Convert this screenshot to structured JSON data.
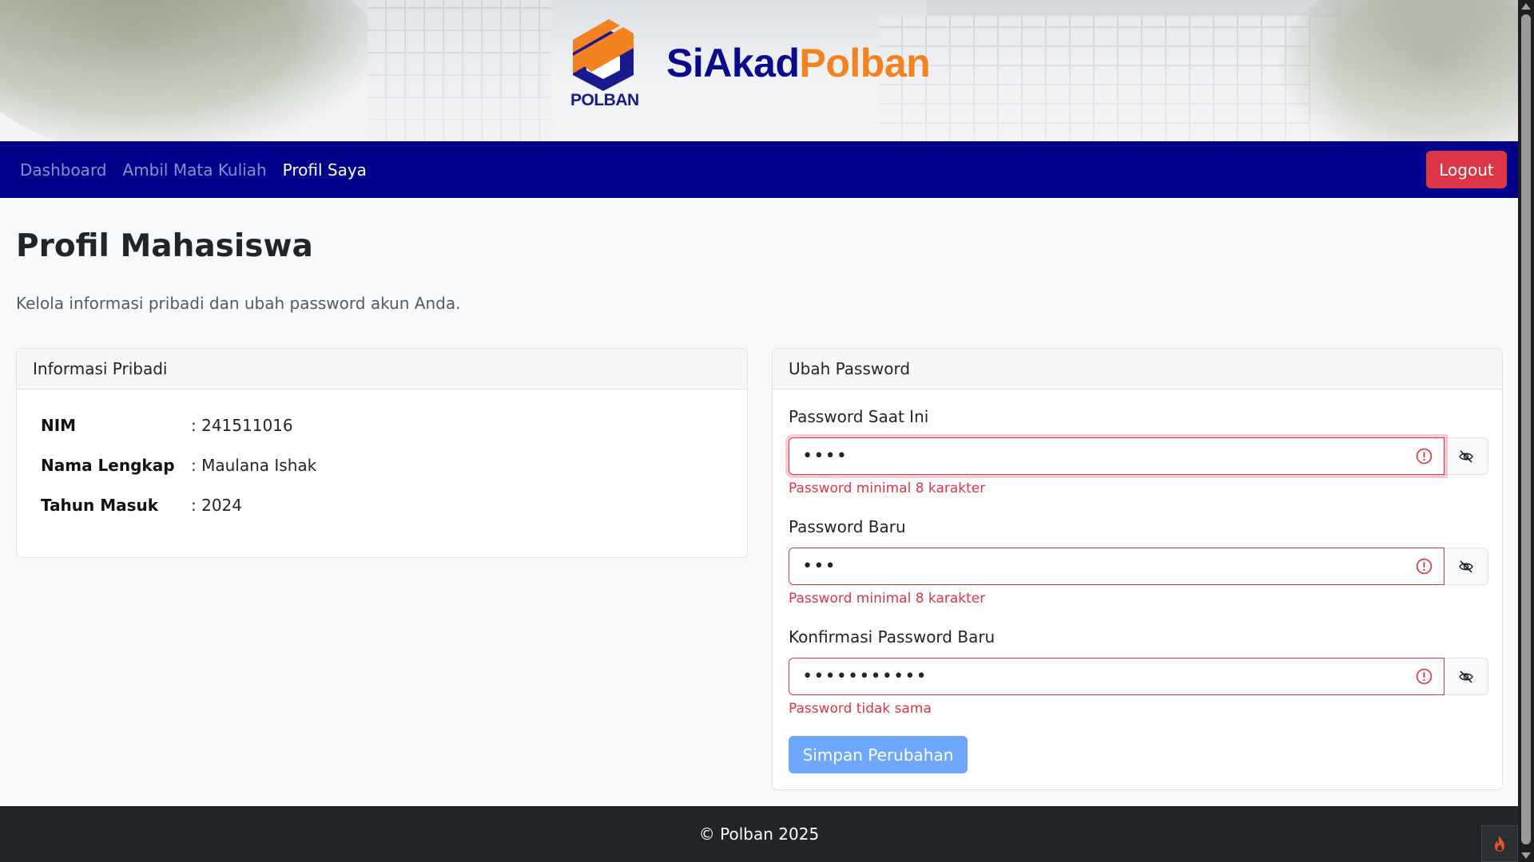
{
  "header": {
    "logo_text": "POLBAN",
    "brand_part1": "SiAkad",
    "brand_part2": "Polban"
  },
  "nav": {
    "items": [
      {
        "label": "Dashboard",
        "active": false
      },
      {
        "label": "Ambil Mata Kuliah",
        "active": false
      },
      {
        "label": "Profil Saya",
        "active": true
      }
    ],
    "logout_label": "Logout"
  },
  "page": {
    "title": "Profil Mahasiswa",
    "subtitle": "Kelola informasi pribadi dan ubah password akun Anda."
  },
  "personal_info": {
    "header": "Informasi Pribadi",
    "rows": [
      {
        "label": "NIM",
        "value": ": 241511016"
      },
      {
        "label": "Nama Lengkap",
        "value": ": Maulana Ishak"
      },
      {
        "label": "Tahun Masuk",
        "value": ": 2024"
      }
    ]
  },
  "change_password": {
    "header": "Ubah Password",
    "fields": [
      {
        "label": "Password Saat Ini",
        "masked_value": "••••",
        "error": "Password minimal 8 karakter"
      },
      {
        "label": "Password Baru",
        "masked_value": "•••",
        "error": "Password minimal 8 karakter"
      },
      {
        "label": "Konfirmasi Password Baru",
        "masked_value": "•••••••••••",
        "error": "Password tidak sama"
      }
    ],
    "submit_label": "Simpan Perubahan"
  },
  "footer": {
    "text": "© Polban 2025"
  },
  "colors": {
    "navbar": "#00008b",
    "brand_blue": "#0a0a8c",
    "brand_orange": "#f58220",
    "danger": "#dc3545",
    "primary_disabled": "#6ea8fe",
    "footer": "#212529"
  },
  "icons": [
    "alert-circle-icon",
    "eye-slash-icon",
    "fire-icon",
    "polban-logo"
  ]
}
